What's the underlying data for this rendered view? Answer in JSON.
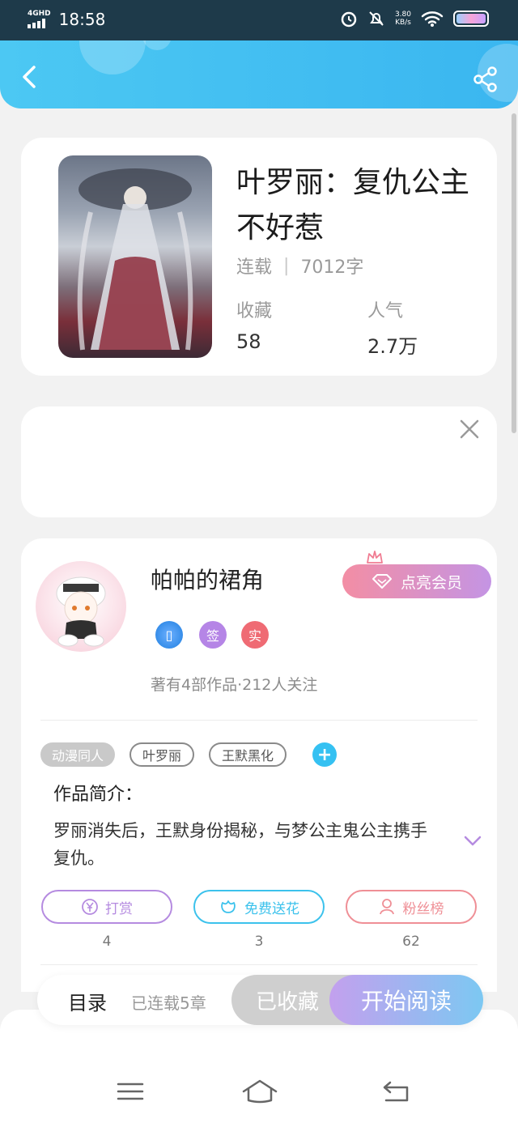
{
  "status_bar": {
    "network": "4GHD",
    "time": "18:58",
    "speed_value": "3.80",
    "speed_unit": "KB/s",
    "icons": [
      "alarm-icon",
      "mute-icon",
      "wifi-icon",
      "battery-icon"
    ]
  },
  "header": {
    "back_icon": "chevron-left-icon",
    "share_icon": "share-icon",
    "color": "#3ab6f0"
  },
  "book": {
    "title": "叶罗丽：复仇公主不好惹",
    "status": "连载",
    "word_count": "7012字",
    "favorites_label": "收藏",
    "favorites_value": "58",
    "popularity_label": "人气",
    "popularity_value": "2.7万"
  },
  "ad": {
    "close_icon": "close-icon"
  },
  "author": {
    "name": "帕帕的裙角",
    "vip_label": "点亮会员",
    "badges": [
      "▯",
      "签",
      "实"
    ],
    "stats": "著有4部作品·212人关注"
  },
  "tags": [
    "动漫同人",
    "叶罗丽",
    "王默黑化"
  ],
  "intro": {
    "title": "作品简介：",
    "text": "罗丽消失后，王默身份揭秘，与梦公主鬼公主携手复仇。"
  },
  "actions": [
    {
      "label": "打赏",
      "count": "4",
      "color": "#b58be0"
    },
    {
      "label": "免费送花",
      "count": "3",
      "color": "#3cc2ec"
    },
    {
      "label": "粉丝榜",
      "count": "62",
      "color": "#ef8f96"
    }
  ],
  "bottom_bar": {
    "catalog": "目录",
    "chapters": "已连载5章",
    "collected": "已收藏",
    "read": "开始阅读"
  }
}
